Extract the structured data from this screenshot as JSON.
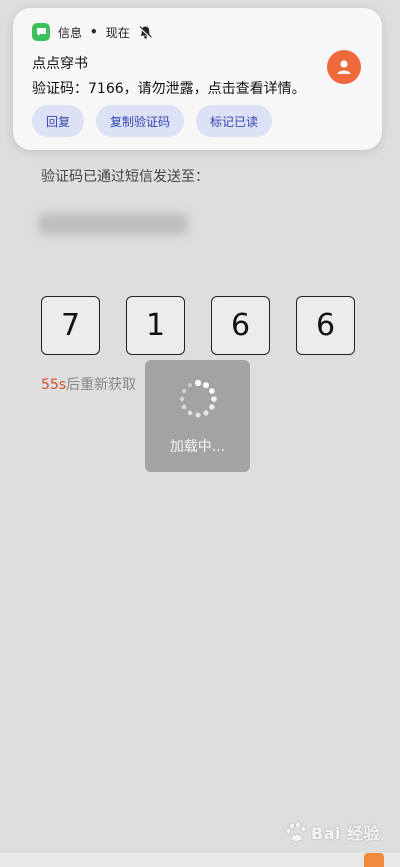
{
  "notification": {
    "app_name": "信息",
    "separator": "•",
    "time": "现在",
    "sender": "点点穿书",
    "message": "验证码：7166，请勿泄露，点击查看详情。",
    "actions": [
      {
        "label": "回复"
      },
      {
        "label": "复制验证码"
      },
      {
        "label": "标记已读"
      }
    ],
    "app_icon_color": "#3ec15a",
    "avatar_color": "#ee6a3c"
  },
  "page": {
    "sent_label": "验证码已通过短信发送至：",
    "code_digits": [
      "7",
      "1",
      "6",
      "6"
    ],
    "resend": {
      "countdown": "55s",
      "text": "后重新获取"
    },
    "countdown_color": "#d4532f"
  },
  "loading": {
    "text": "加载中..."
  },
  "watermark": {
    "text": "Bai  经验"
  }
}
